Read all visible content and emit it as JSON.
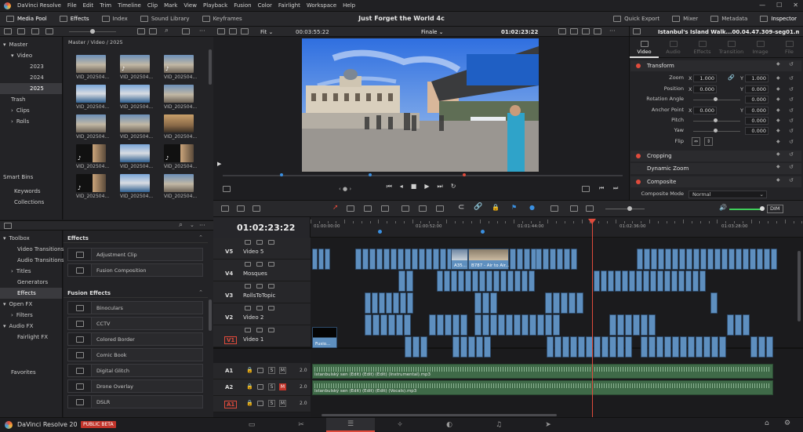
{
  "menubar": {
    "app_name": "DaVinci Resolve",
    "items": [
      "File",
      "Edit",
      "Trim",
      "Timeline",
      "Clip",
      "Mark",
      "View",
      "Playback",
      "Fusion",
      "Color",
      "Fairlight",
      "Workspace",
      "Help"
    ]
  },
  "toolbar": {
    "left": [
      {
        "label": "Media Pool",
        "icon": "media-pool-icon",
        "on": true
      },
      {
        "label": "Effects",
        "icon": "effects-icon",
        "on": true
      },
      {
        "label": "Index",
        "icon": "index-icon",
        "on": false
      },
      {
        "label": "Sound Library",
        "icon": "sound-library-icon",
        "on": false
      },
      {
        "label": "Keyframes",
        "icon": "keyframes-icon",
        "on": false
      }
    ],
    "project_title": "Just Forget the World 4c",
    "right": [
      {
        "label": "Quick Export",
        "icon": "quick-export-icon",
        "on": false
      },
      {
        "label": "Mixer",
        "icon": "mixer-icon",
        "on": false
      },
      {
        "label": "Metadata",
        "icon": "metadata-icon",
        "on": false
      },
      {
        "label": "Inspector",
        "icon": "inspector-icon",
        "on": true
      }
    ]
  },
  "viewer": {
    "zoom": "Fit",
    "source_timecode": "00:03:55:22",
    "timeline_name": "Finale",
    "record_timecode": "01:02:23:22",
    "clip_name": "Istanbul's Island Walk...00.04.47.309-seg01.mp4"
  },
  "media_pool": {
    "path": "Master / Video / 2025",
    "bins": [
      {
        "label": "Master",
        "level": 0,
        "sel": false,
        "arrow": "▾"
      },
      {
        "label": "Video",
        "level": 1,
        "sel": false,
        "arrow": "▾"
      },
      {
        "label": "2023",
        "level": 2,
        "sel": false,
        "arrow": ""
      },
      {
        "label": "2024",
        "level": 2,
        "sel": false,
        "arrow": ""
      },
      {
        "label": "2025",
        "level": 2,
        "sel": true,
        "arrow": ""
      },
      {
        "label": "Trash",
        "level": 1,
        "sel": false,
        "arrow": ""
      },
      {
        "label": "Clips",
        "level": 1,
        "sel": false,
        "arrow": "›"
      },
      {
        "label": "Rolls",
        "level": 1,
        "sel": false,
        "arrow": "›"
      }
    ],
    "smart_bins_label": "Smart Bins",
    "smart_bins": [
      "Keywords",
      "Collections"
    ],
    "clip_label": "VID_202504...",
    "thumbs": [
      {
        "kind": "scene",
        "music": false
      },
      {
        "kind": "scene",
        "music": true
      },
      {
        "kind": "scene",
        "music": true
      },
      {
        "kind": "sea",
        "music": false
      },
      {
        "kind": "sea",
        "music": false
      },
      {
        "kind": "scene",
        "music": false
      },
      {
        "kind": "scene",
        "music": false
      },
      {
        "kind": "scene",
        "music": false
      },
      {
        "kind": "warm",
        "music": false
      },
      {
        "kind": "black",
        "music": true
      },
      {
        "kind": "sea",
        "music": false
      },
      {
        "kind": "black",
        "music": true
      },
      {
        "kind": "black",
        "music": true
      },
      {
        "kind": "sea",
        "music": false
      },
      {
        "kind": "scene",
        "music": false
      }
    ]
  },
  "effects_library": {
    "toolbox_label": "Toolbox",
    "tree": [
      {
        "label": "Video Transitions",
        "sel": false
      },
      {
        "label": "Audio Transitions",
        "sel": false
      },
      {
        "label": "Titles",
        "sel": false
      },
      {
        "label": "Generators",
        "sel": false
      },
      {
        "label": "Effects",
        "sel": true
      },
      {
        "label": "Open FX",
        "sel": false
      },
      {
        "label": "Filters",
        "sel": false
      },
      {
        "label": "Audio FX",
        "sel": false
      },
      {
        "label": "Fairlight FX",
        "sel": false
      }
    ],
    "favorites_label": "Favorites",
    "effects_header": "Effects",
    "effects": [
      "Adjustment Clip",
      "Fusion Composition"
    ],
    "fusion_header": "Fusion Effects",
    "fusion_effects": [
      "Binoculars",
      "CCTV",
      "Colored Border",
      "Comic Book",
      "Digital Glitch",
      "Drone Overlay",
      "DSLR",
      "DVE"
    ]
  },
  "inspector": {
    "tabs": [
      "Video",
      "Audio",
      "Effects",
      "Transition",
      "Image",
      "File"
    ],
    "transform_label": "Transform",
    "zoom_label": "Zoom",
    "zoom_x": "1.000",
    "zoom_y": "1.000",
    "position_label": "Position",
    "position_x": "0.000",
    "position_y": "0.000",
    "rotation_label": "Rotation Angle",
    "rotation": "0.000",
    "anchor_label": "Anchor Point",
    "anchor_x": "0.000",
    "anchor_y": "0.000",
    "pitch_label": "Pitch",
    "pitch": "0.000",
    "yaw_label": "Yaw",
    "yaw": "0.000",
    "flip_label": "Flip",
    "x_label": "X",
    "y_label": "Y",
    "sections": [
      "Cropping",
      "Dynamic Zoom",
      "Composite"
    ],
    "composite_mode_label": "Composite Mode",
    "composite_mode": "Normal"
  },
  "timeline": {
    "timecode": "01:02:23:22",
    "ruler": [
      "01:00:00:00",
      "01:00:52:00",
      "01:01:44:00",
      "01:02:36:00",
      "01:03:28:00"
    ],
    "video_tracks": [
      {
        "id": "V5",
        "name": "Video 5"
      },
      {
        "id": "V4",
        "name": "Mosques"
      },
      {
        "id": "V3",
        "name": "RollsToTopic"
      },
      {
        "id": "V2",
        "name": "Video 2"
      },
      {
        "id": "V1",
        "name": "Video 1"
      }
    ],
    "audio_tracks": [
      {
        "id": "A1",
        "level": "2.0",
        "clip": "Istanbulský sen (Edit) (Edit) (Edit) (Instrumental).mp3"
      },
      {
        "id": "A2",
        "level": "2.0",
        "clip": "Istanbulský sen (Edit) (Edit) (Edit) (Vocals).mp3"
      },
      {
        "id": "A1",
        "level": "2.0",
        "clip": ""
      }
    ],
    "clip_labels": [
      "A35...",
      "B787 - Air to Air...",
      "Fusio..."
    ],
    "audio_m": "M",
    "audio_s": "S",
    "volume_label": "DIM"
  },
  "statusbar": {
    "app": "DaVinci Resolve 20",
    "badge": "PUBLIC BETA"
  }
}
